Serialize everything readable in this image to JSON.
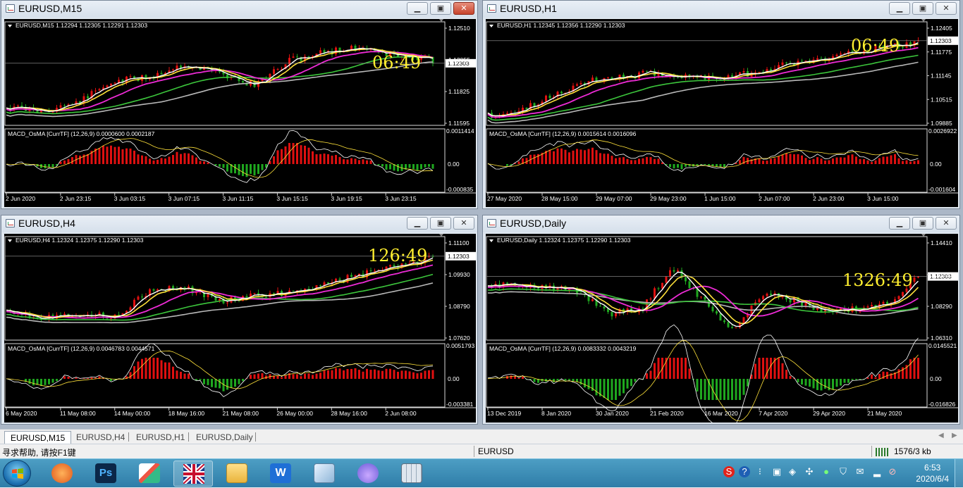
{
  "windows": [
    {
      "title": "EURUSD,M15",
      "header": "EURUSD,M15  1.12294  1.12305  1.12291  1.12303",
      "timer": "06:49",
      "price_ticks": [
        "1.12510",
        "1.12055",
        "1.11825",
        "1.11595"
      ],
      "price_current": "1.12303",
      "macd_header": "MACD_OsMA [CurrTF] (12,26,9) 0.0000600 0.0002187",
      "macd_ticks": [
        "0.0011414",
        "0.00",
        "-0.000835"
      ],
      "time_labels": [
        "2 Jun 2020",
        "2 Jun 23:15",
        "3 Jun 03:15",
        "3 Jun 07:15",
        "3 Jun 11:15",
        "3 Jun 15:15",
        "3 Jun 19:15",
        "3 Jun 23:15"
      ],
      "close_active": true
    },
    {
      "title": "EURUSD,H1",
      "header": "EURUSD,H1  1.12345  1.12356  1.12290  1.12303",
      "timer": "06:49",
      "price_ticks": [
        "1.12405",
        "1.11775",
        "1.11145",
        "1.10515",
        "1.09885"
      ],
      "price_current": "1.12303",
      "macd_header": "MACD_OsMA [CurrTF] (12,26,9) 0.0015614 0.0016096",
      "macd_ticks": [
        "0.0026922",
        "0.00",
        "-0.001604"
      ],
      "time_labels": [
        "27 May 2020",
        "28 May 15:00",
        "29 May 07:00",
        "29 May 23:00",
        "1 Jun 15:00",
        "2 Jun 07:00",
        "2 Jun 23:00",
        "3 Jun 15:00"
      ],
      "close_active": false
    },
    {
      "title": "EURUSD,H4",
      "header": "EURUSD,H4  1.12324  1.12375  1.12290  1.12303",
      "timer": "126:49",
      "price_ticks": [
        "1.11100",
        "1.09930",
        "1.08790",
        "1.07620"
      ],
      "price_current": "1.12303",
      "macd_header": "MACD_OsMA [CurrTF] (12,26,9) 0.0046783 0.0044571",
      "macd_ticks": [
        "0.0051793",
        "0.00",
        "-0.003381"
      ],
      "time_labels": [
        "6 May 2020",
        "11 May 08:00",
        "14 May 00:00",
        "18 May 16:00",
        "21 May 08:00",
        "26 May 00:00",
        "28 May 16:00",
        "2 Jun 08:00"
      ],
      "close_active": false
    },
    {
      "title": "EURUSD,Daily",
      "header": "EURUSD,Daily  1.12324  1.12375  1.12290  1.12303",
      "timer": "1326:49",
      "price_ticks": [
        "1.14410",
        "1.10330",
        "1.08290",
        "1.06310"
      ],
      "price_current": "1.12303",
      "macd_header": "MACD_OsMA [CurrTF] (12,26,9) 0.0083332 0.0043219",
      "macd_ticks": [
        "0.0145521",
        "0.00",
        "-0.016826"
      ],
      "time_labels": [
        "13 Dec 2019",
        "8 Jan 2020",
        "30 Jan 2020",
        "21 Feb 2020",
        "16 Mar 2020",
        "7 Apr 2020",
        "29 Apr 2020",
        "21 May 2020"
      ],
      "close_active": false
    }
  ],
  "tabs": [
    "EURUSD,M15",
    "EURUSD,H4",
    "EURUSD,H1",
    "EURUSD,Daily"
  ],
  "active_tab": "EURUSD,M15",
  "status": {
    "help": "寻求帮助, 请按F1键",
    "symbol": "EURUSD",
    "traffic": "1576/3 kb"
  },
  "taskbar": {
    "time": "6:53",
    "date": "2020/6/4",
    "apps": [
      "bird-app-icon",
      "photoshop-icon",
      "paint-icon",
      "uk-flag-icon",
      "file-explorer-icon",
      "wps-writer-icon",
      "notebook-icon",
      "cloud-app-icon",
      "calculator-icon"
    ]
  },
  "colors": {
    "bull": "#e01010",
    "bear": "#1fa81f",
    "timer": "#ffef2f",
    "ma_fast": "#ffffff",
    "ma_yellow": "#ffe23a",
    "ma_magenta": "#ee2bd6",
    "ma_green": "#3cc63c",
    "ma_gray": "#b8b8b8"
  }
}
